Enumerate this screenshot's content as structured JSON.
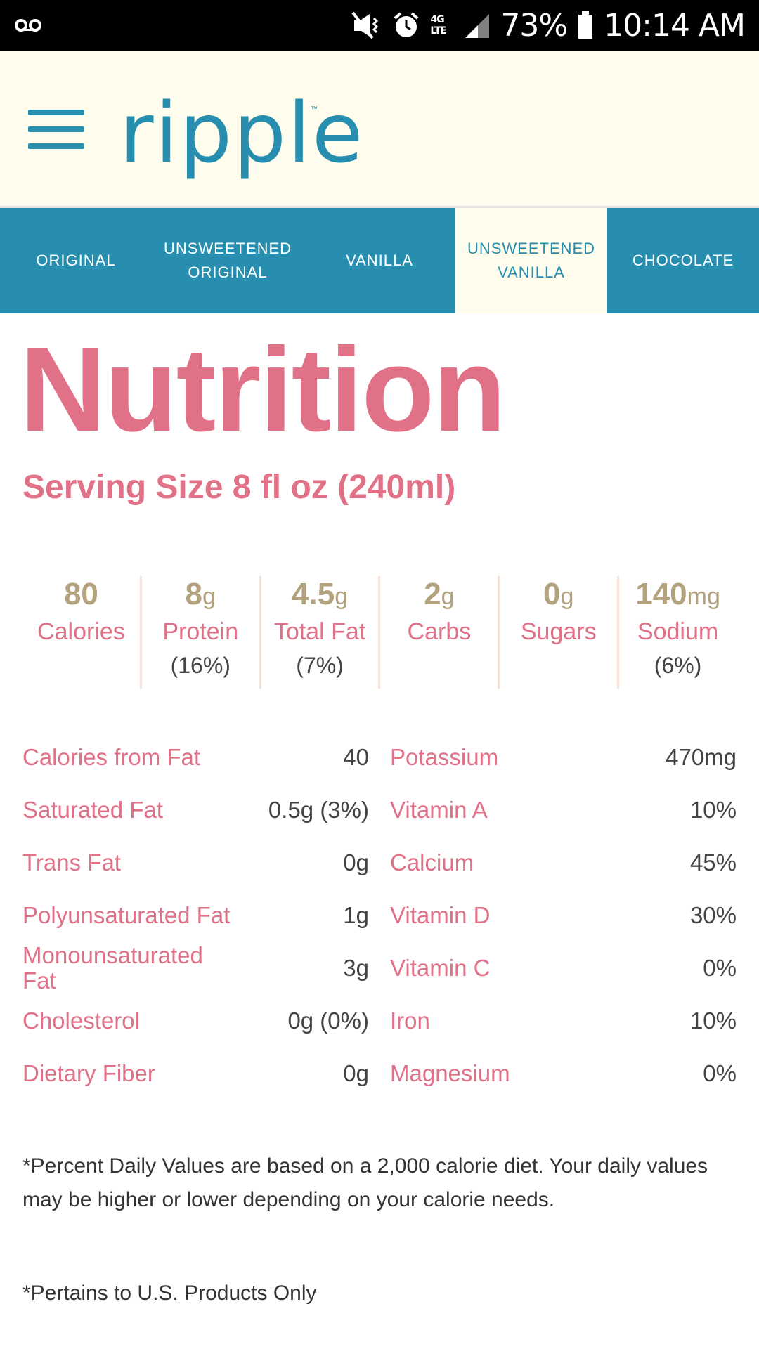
{
  "status_bar": {
    "battery": "73%",
    "time": "10:14 AM",
    "network": "4G LTE",
    "icons": [
      "voicemail-icon",
      "mute-vibrate-icon",
      "alarm-icon",
      "signal-icon",
      "battery-icon"
    ]
  },
  "header": {
    "logo_text": "ripple",
    "logo_tm": "™",
    "colors": {
      "brand": "#278eaf",
      "background": "#fefdee"
    }
  },
  "tabs": [
    {
      "label": "ORIGINAL",
      "active": false
    },
    {
      "label": "UNSWEETENED ORIGINAL",
      "active": false
    },
    {
      "label": "VANILLA",
      "active": false
    },
    {
      "label": "UNSWEETENED VANILLA",
      "active": true
    },
    {
      "label": "CHOCOLATE",
      "active": false
    }
  ],
  "nutrition": {
    "title": "Nutrition",
    "serving": "Serving Size 8 fl oz (240ml)",
    "summary": [
      {
        "value": "80",
        "unit": "",
        "label": "Calories",
        "pct": ""
      },
      {
        "value": "8",
        "unit": "g",
        "label": "Protein",
        "pct": "(16%)"
      },
      {
        "value": "4.5",
        "unit": "g",
        "label": "Total Fat",
        "pct": "(7%)"
      },
      {
        "value": "2",
        "unit": "g",
        "label": "Carbs",
        "pct": ""
      },
      {
        "value": "0",
        "unit": "g",
        "label": "Sugars",
        "pct": ""
      },
      {
        "value": "140",
        "unit": "mg",
        "label": "Sodium",
        "pct": "(6%)"
      }
    ],
    "left_details": [
      {
        "label": "Calories from Fat",
        "value": "40"
      },
      {
        "label": "Saturated Fat",
        "value": "0.5g (3%)"
      },
      {
        "label": "Trans Fat",
        "value": "0g"
      },
      {
        "label": "Polyunsaturated Fat",
        "value": "1g"
      },
      {
        "label": "Monounsaturated Fat",
        "value": "3g"
      },
      {
        "label": "Cholesterol",
        "value": "0g (0%)"
      },
      {
        "label": "Dietary Fiber",
        "value": "0g"
      }
    ],
    "right_details": [
      {
        "label": "Potassium",
        "value": "470mg"
      },
      {
        "label": "Vitamin A",
        "value": "10%"
      },
      {
        "label": "Calcium",
        "value": "45%"
      },
      {
        "label": "Vitamin D",
        "value": "30%"
      },
      {
        "label": "Vitamin C",
        "value": "0%"
      },
      {
        "label": "Iron",
        "value": "10%"
      },
      {
        "label": "Magnesium",
        "value": "0%"
      }
    ],
    "footnote": "*Percent Daily Values are based on a 2,000 calorie diet. Your daily values may be higher or lower depending on your calorie needs.",
    "footnote2": "*Pertains to U.S. Products Only",
    "colors": {
      "pink": "#e07187",
      "gold": "#b3a27e"
    }
  }
}
